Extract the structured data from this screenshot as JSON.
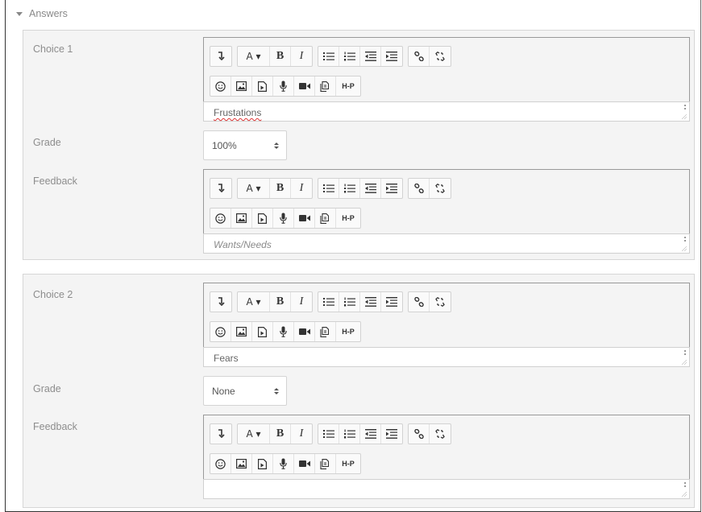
{
  "section": {
    "title": "Answers"
  },
  "toolbar": {
    "row1": [
      [
        "collapse-icon"
      ],
      [
        "font-color-icon",
        "bold-icon",
        "italic-icon"
      ],
      [
        "unordered-list-icon",
        "ordered-list-icon",
        "outdent-icon",
        "indent-icon"
      ],
      [
        "link-icon",
        "unlink-icon"
      ]
    ],
    "row2": [
      "emoji-icon",
      "image-icon",
      "media-icon",
      "record-audio-icon",
      "record-video-icon",
      "manage-files-icon",
      "h5p-icon"
    ],
    "font_glyph": "A ▾",
    "bold_glyph": "B",
    "italic_glyph": "I",
    "h5p_glyph": "H-P"
  },
  "choices": [
    {
      "label": "Choice 1",
      "answer": "Frustations",
      "grade_label": "Grade",
      "grade_value": "100%",
      "feedback_label": "Feedback",
      "feedback_placeholder": "Wants/Needs"
    },
    {
      "label": "Choice 2",
      "answer": "Fears",
      "grade_label": "Grade",
      "grade_value": "None",
      "feedback_label": "Feedback",
      "feedback_placeholder": ""
    }
  ]
}
